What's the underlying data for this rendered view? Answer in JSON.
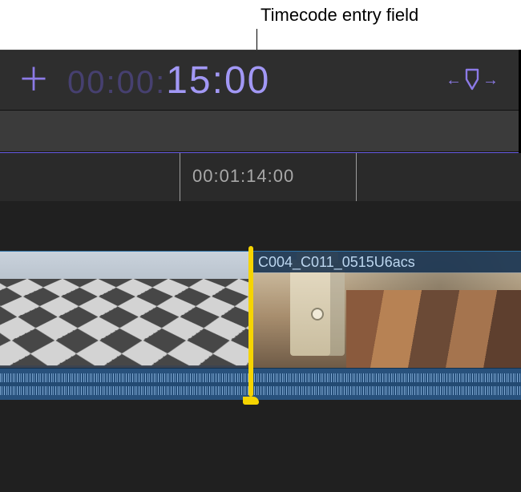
{
  "annotation": {
    "label": "Timecode entry field"
  },
  "toolbar": {
    "timecode_muted": "00:00:",
    "timecode_active": "15:00",
    "plus_glyph": "＋",
    "arrow_left": "←",
    "arrow_right": "→"
  },
  "ruler": {
    "playhead_timecode": "00:01:14:00"
  },
  "clips": {
    "a": {
      "label": ""
    },
    "b": {
      "label": "C004_C011_0515U6acs"
    }
  },
  "colors": {
    "accent": "#8c7ae6",
    "edit_point": "#f5d400"
  }
}
